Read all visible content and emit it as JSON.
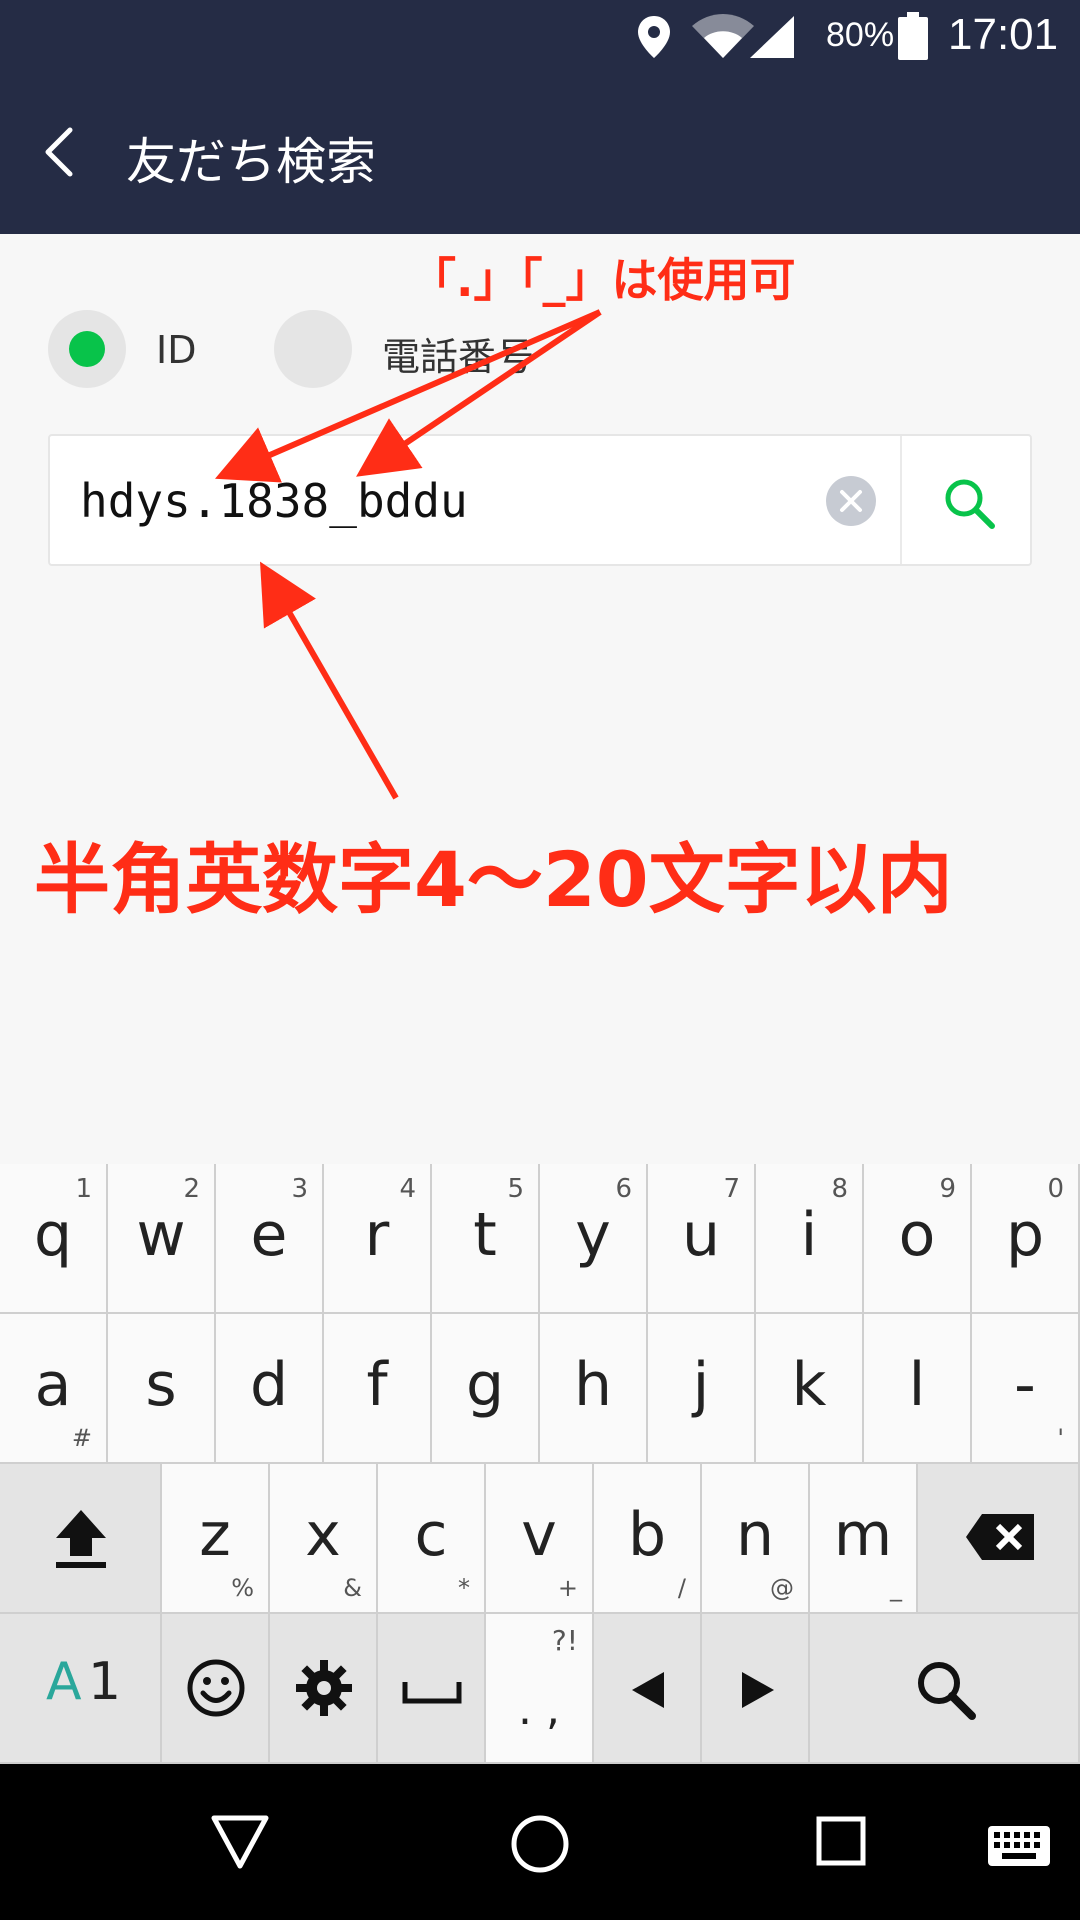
{
  "status": {
    "battery": "80%",
    "time": "17:01"
  },
  "header": {
    "title": "友だち検索"
  },
  "search_type": {
    "options": [
      {
        "label": "ID",
        "selected": true
      },
      {
        "label": "電話番号",
        "selected": false
      }
    ]
  },
  "search": {
    "value": "hdys.1838_bddu"
  },
  "annotations": {
    "allowed_chars": "「.」「_」は使用可",
    "length_rule": "半角英数字4〜20文字以内"
  },
  "keyboard": {
    "row1": [
      {
        "main": "q",
        "sup": "1"
      },
      {
        "main": "w",
        "sup": "2"
      },
      {
        "main": "e",
        "sup": "3"
      },
      {
        "main": "r",
        "sup": "4"
      },
      {
        "main": "t",
        "sup": "5"
      },
      {
        "main": "y",
        "sup": "6"
      },
      {
        "main": "u",
        "sup": "7"
      },
      {
        "main": "i",
        "sup": "8"
      },
      {
        "main": "o",
        "sup": "9"
      },
      {
        "main": "p",
        "sup": "0"
      }
    ],
    "row2": [
      {
        "main": "a",
        "sub": "#"
      },
      {
        "main": "s",
        "sub": ""
      },
      {
        "main": "d",
        "sub": ""
      },
      {
        "main": "f",
        "sub": ""
      },
      {
        "main": "g",
        "sub": ""
      },
      {
        "main": "h",
        "sub": ""
      },
      {
        "main": "j",
        "sub": ""
      },
      {
        "main": "k",
        "sub": ""
      },
      {
        "main": "l",
        "sub": ""
      },
      {
        "main": "-",
        "sub": "'"
      }
    ],
    "row3": [
      {
        "main": "z",
        "sub": "%"
      },
      {
        "main": "x",
        "sub": "&"
      },
      {
        "main": "c",
        "sub": "*"
      },
      {
        "main": "v",
        "sub": "+"
      },
      {
        "main": "b",
        "sub": "/"
      },
      {
        "main": "n",
        "sub": "@"
      },
      {
        "main": "m",
        "sub": "_"
      }
    ],
    "mode_key": {
      "a": "A",
      "n": "1"
    },
    "punct_key": {
      "top": "?!",
      "bottom": ". ,"
    },
    "colors": {
      "mode_accent": "#2aa79b"
    }
  },
  "colors": {
    "header_bg": "#252c45",
    "accent_green": "#08c34a",
    "annotation_red": "#ff2d16"
  }
}
